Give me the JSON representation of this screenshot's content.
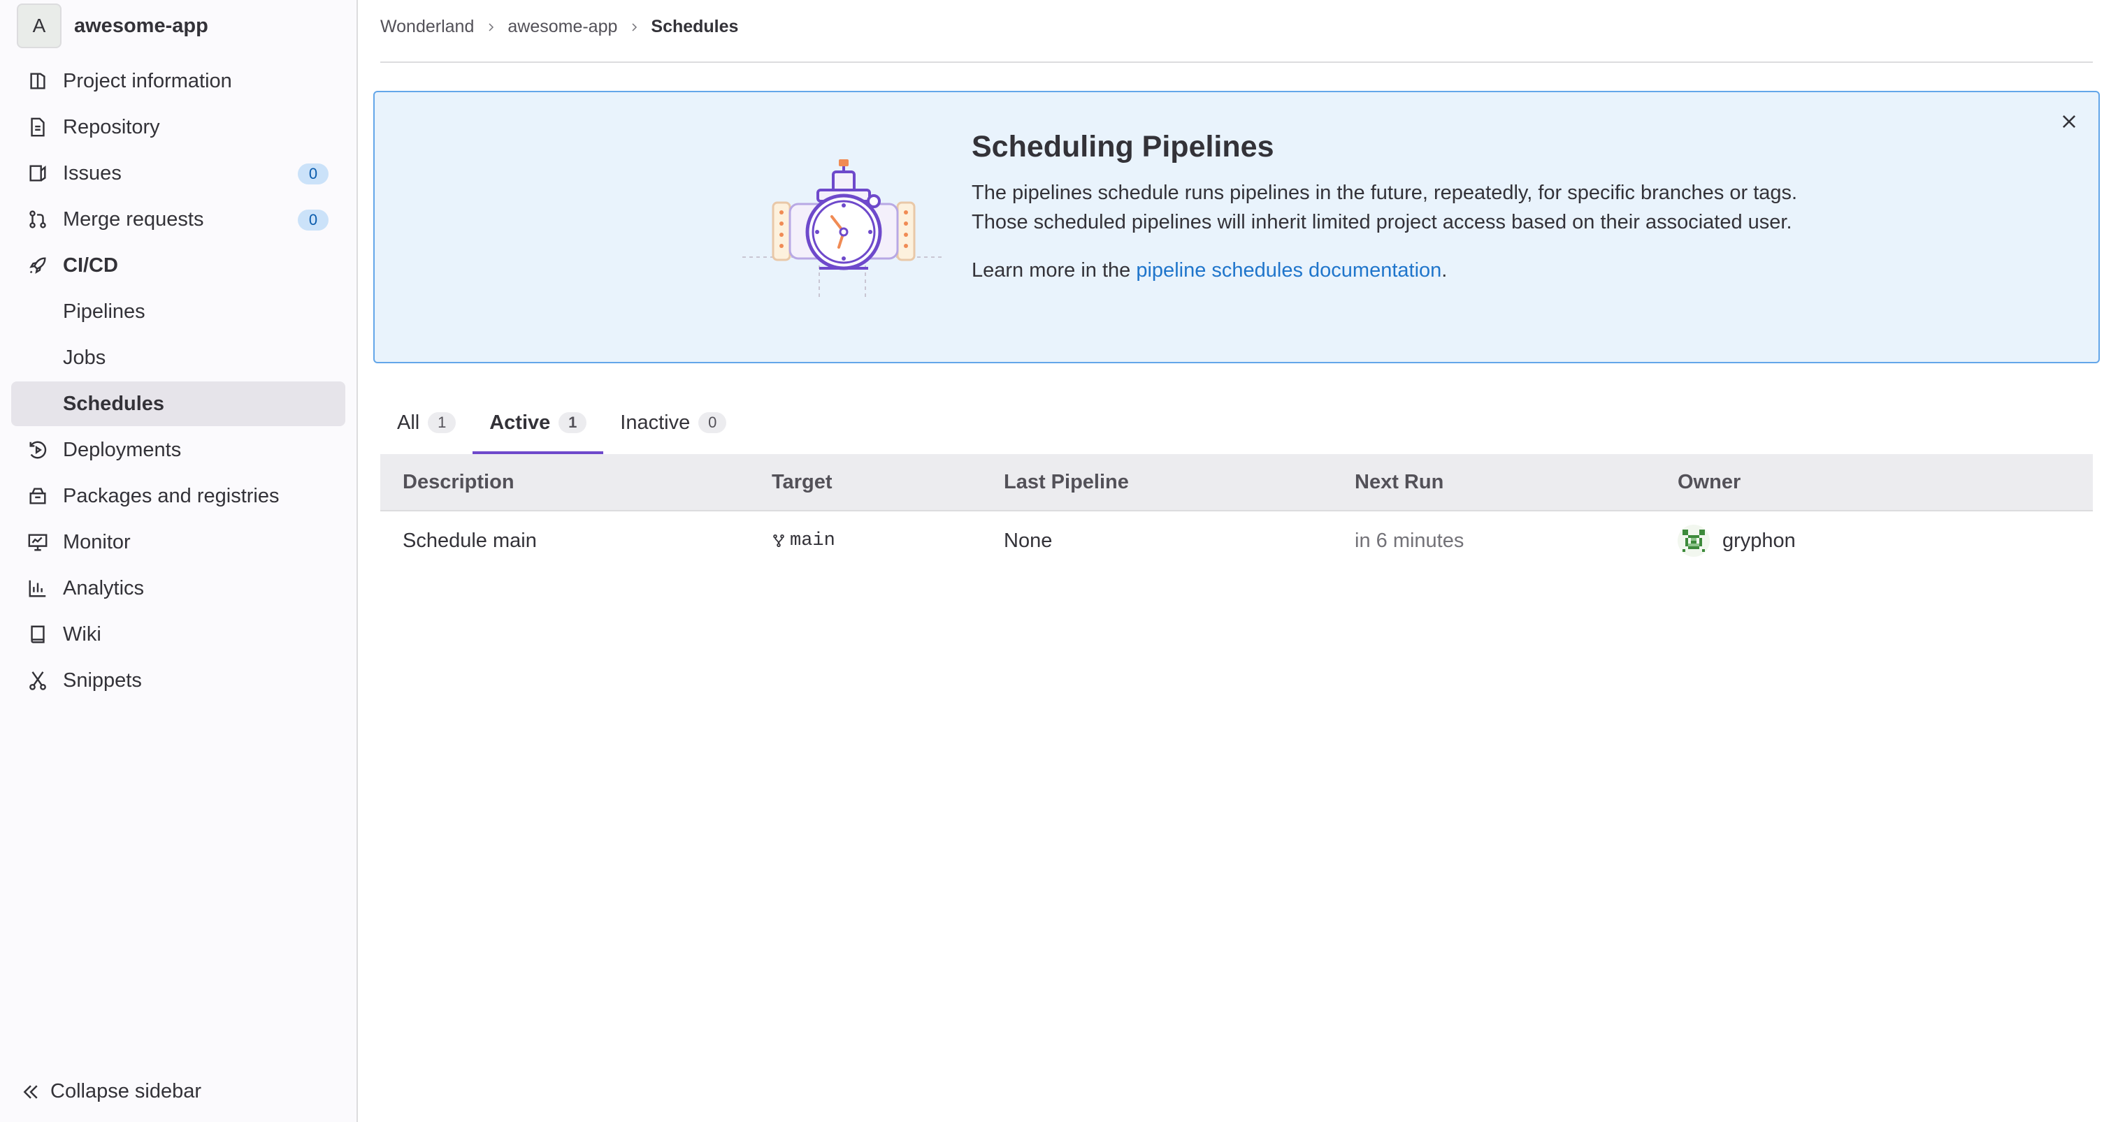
{
  "project": {
    "avatar_letter": "A",
    "name": "awesome-app"
  },
  "sidebar": {
    "items": [
      {
        "label": "Project information",
        "icon": "project-info-icon"
      },
      {
        "label": "Repository",
        "icon": "document-icon"
      },
      {
        "label": "Issues",
        "icon": "issues-icon",
        "count": "0"
      },
      {
        "label": "Merge requests",
        "icon": "merge-request-icon",
        "count": "0"
      },
      {
        "label": "CI/CD",
        "icon": "rocket-icon"
      },
      {
        "label": "Pipelines"
      },
      {
        "label": "Jobs"
      },
      {
        "label": "Schedules"
      },
      {
        "label": "Deployments",
        "icon": "deployments-icon"
      },
      {
        "label": "Packages and registries",
        "icon": "package-icon"
      },
      {
        "label": "Monitor",
        "icon": "monitor-icon"
      },
      {
        "label": "Analytics",
        "icon": "chart-icon"
      },
      {
        "label": "Wiki",
        "icon": "book-icon"
      },
      {
        "label": "Snippets",
        "icon": "snippet-icon"
      }
    ],
    "collapse_label": "Collapse sidebar"
  },
  "breadcrumb": {
    "items": [
      "Wonderland",
      "awesome-app",
      "Schedules"
    ]
  },
  "banner": {
    "title": "Scheduling Pipelines",
    "body": "The pipelines schedule runs pipelines in the future, repeatedly, for specific branches or tags. Those scheduled pipelines will inherit limited project access based on their associated user.",
    "learn_prefix": "Learn more in the ",
    "learn_link": "pipeline schedules documentation",
    "learn_suffix": "."
  },
  "tabs": [
    {
      "label": "All",
      "count": "1"
    },
    {
      "label": "Active",
      "count": "1"
    },
    {
      "label": "Inactive",
      "count": "0"
    }
  ],
  "table": {
    "headers": [
      "Description",
      "Target",
      "Last Pipeline",
      "Next Run",
      "Owner"
    ],
    "rows": [
      {
        "description": "Schedule main",
        "target": "main",
        "last_pipeline": "None",
        "next_run": "in 6 minutes",
        "owner": "gryphon"
      }
    ]
  },
  "colors": {
    "accent": "#6e49cb",
    "link": "#1f75cb",
    "banner_bg": "#e9f3fc",
    "banner_border": "#63a6e9"
  }
}
